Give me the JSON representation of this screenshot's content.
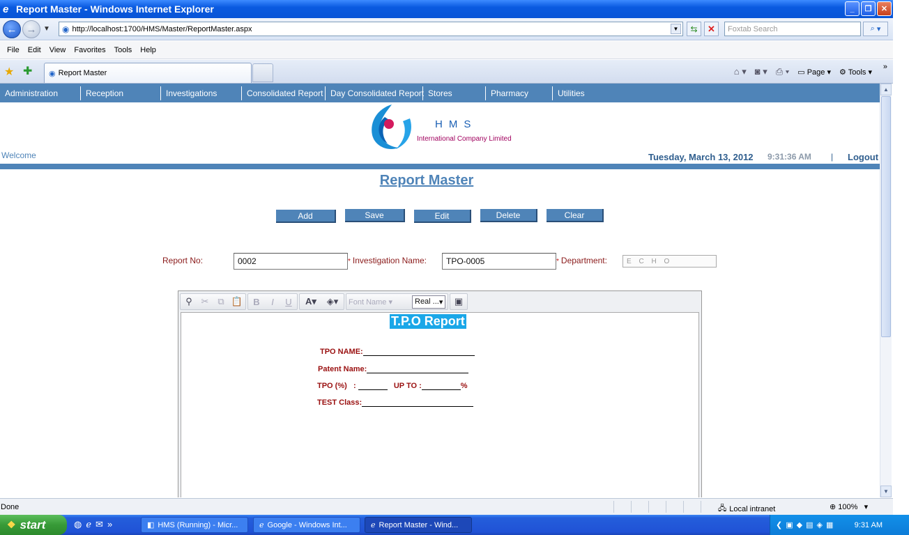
{
  "window": {
    "title": "Report Master - Windows Internet Explorer"
  },
  "browser": {
    "url": "http://localhost:1700/HMS/Master/ReportMaster.aspx",
    "search_placeholder": "Foxtab Search",
    "menu": [
      "File",
      "Edit",
      "View",
      "Favorites",
      "Tools",
      "Help"
    ],
    "tab_title": "Report Master",
    "cmd_page": "Page",
    "cmd_tools": "Tools"
  },
  "app": {
    "nav": [
      "Administration",
      "Reception",
      "Investigations",
      "Consolidated Report",
      "Day Consolidated Report",
      "Stores",
      "Pharmacy",
      "Utilities"
    ],
    "logo_title": "HMS",
    "logo_subtitle": "International Company Limited",
    "welcome": "Welcome",
    "date": "Tuesday, March 13, 2012",
    "time": "9:31:36 AM",
    "separator": "|",
    "logout": "Logout",
    "page_title": "Report Master",
    "buttons": {
      "add": "Add",
      "save": "Save",
      "edit": "Edit",
      "delete": "Delete",
      "clear": "Clear"
    },
    "form": {
      "report_no_label": "Report No:",
      "report_no_value": "0002",
      "investigation_label": "Investigation Name:",
      "investigation_value": "TPO-0005",
      "department_label": "Department:",
      "department_value": "E C H O",
      "required_marker": "*"
    },
    "editor": {
      "font_name": "Font Name",
      "font_size": "Real ...",
      "report_title": "T.P.O Report",
      "lines": {
        "tpo_name": "TPO NAME:",
        "patent_name": "Patent Name:",
        "tpo_percent": "TPO (%)   :",
        "up_to": "UP TO :",
        "percent": "%",
        "test_class": "TEST Class:"
      }
    }
  },
  "statusbar": {
    "text": "Done",
    "zone": "Local intranet",
    "zoom": "100%"
  },
  "taskbar": {
    "start": "start",
    "tasks": [
      "HMS (Running) - Micr...",
      "Google - Windows Int...",
      "Report Master - Wind..."
    ],
    "clock": "9:31 AM"
  }
}
